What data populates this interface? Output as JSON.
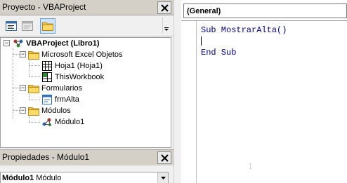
{
  "project_explorer": {
    "title": "Proyecto - VBAProject",
    "toolbar": {
      "view_code_icon": "view-code-icon",
      "view_object_icon": "view-object-icon",
      "toggle_folders_icon": "folder-icon"
    },
    "tree": [
      {
        "label": "VBAProject (Libro1)",
        "icon": "vba-project-icon",
        "expander": "−",
        "bold": true
      },
      {
        "label": "Microsoft Excel Objetos",
        "icon": "folder-icon",
        "expander": "−"
      },
      {
        "label": "Hoja1 (Hoja1)",
        "icon": "worksheet-icon"
      },
      {
        "label": "ThisWorkbook",
        "icon": "workbook-icon"
      },
      {
        "label": "Formularios",
        "icon": "folder-icon",
        "expander": "−"
      },
      {
        "label": "frmAlta",
        "icon": "userform-icon"
      },
      {
        "label": "Módulos",
        "icon": "folder-icon",
        "expander": "−"
      },
      {
        "label": "Módulo1",
        "icon": "module-icon"
      }
    ]
  },
  "properties": {
    "title": "Propiedades - Módulo1",
    "object_name": "Módulo1",
    "object_type": "Módulo"
  },
  "code_window": {
    "object_selector": "(General)",
    "lines": [
      "Sub MostrarAlta()",
      "",
      "End Sub"
    ]
  }
}
